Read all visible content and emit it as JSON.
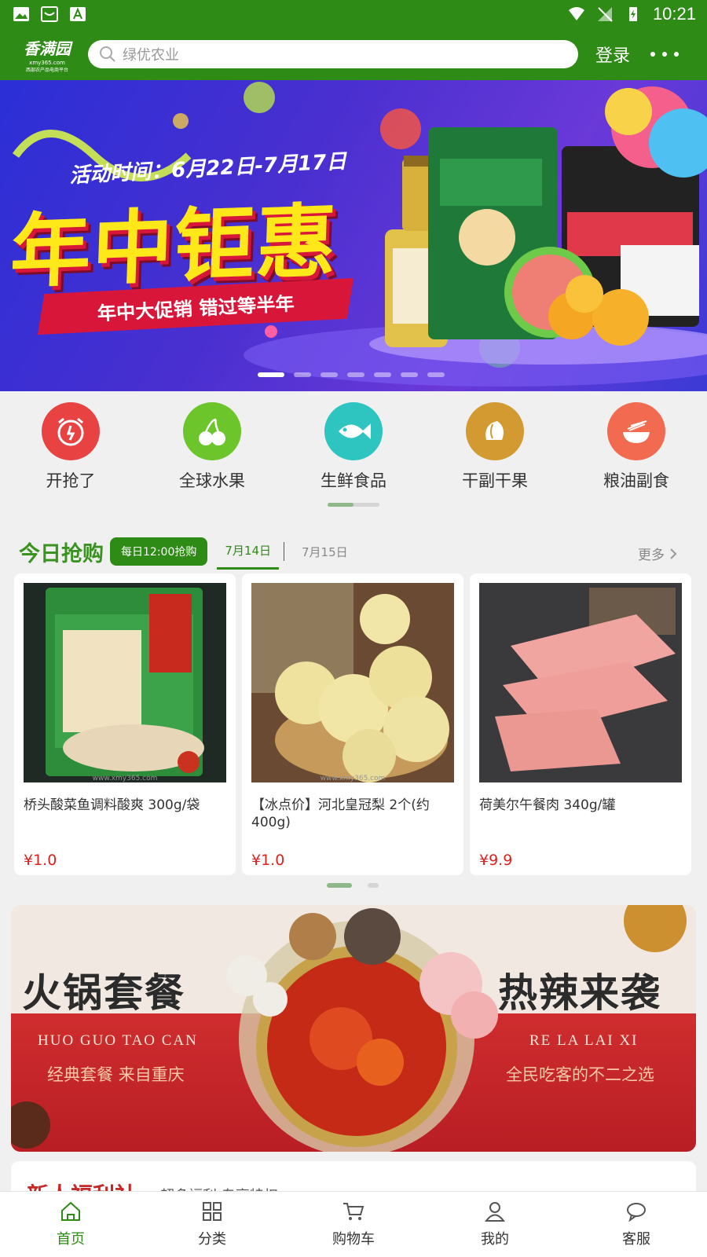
{
  "status_bar": {
    "time": "10:21"
  },
  "header": {
    "logo_text": "香满园",
    "logo_sub": "xmy365.com",
    "logo_tag": "西部农产品电商平台",
    "search_placeholder": "绿优农业",
    "login_label": "登录"
  },
  "banner": {
    "date_text": "活动时间：6月22日-7月17日",
    "title": "年中钜惠",
    "subtitle": "年中大促销 错过等半年",
    "slide_count": 7,
    "active_slide": 1
  },
  "categories": [
    {
      "label": "开抢了",
      "icon": "alarm-clock-icon",
      "color": "#e84242"
    },
    {
      "label": "全球水果",
      "icon": "cherry-icon",
      "color": "#6cc52a"
    },
    {
      "label": "生鲜食品",
      "icon": "fish-icon",
      "color": "#2ec4c0"
    },
    {
      "label": "干副干果",
      "icon": "nut-icon",
      "color": "#d29a30"
    },
    {
      "label": "粮油副食",
      "icon": "rice-bowl-icon",
      "color": "#f26a4f"
    }
  ],
  "flash_sale": {
    "title": "今日抢购",
    "badge": "每日12:00抢购",
    "tabs": [
      "7月14日",
      "7月15日"
    ],
    "more_label": "更多"
  },
  "products": [
    {
      "name": "桥头酸菜鱼调料酸爽 300g/袋",
      "price": "¥1.0",
      "watermark": "www.xmy365.com"
    },
    {
      "name": "【冰点价】河北皇冠梨 2个(约400g)",
      "price": "¥1.0",
      "watermark": "www.xmy365.com"
    },
    {
      "name": "荷美尔午餐肉 340g/罐",
      "price": "¥9.9",
      "watermark": ""
    }
  ],
  "promo": {
    "title_left": "火锅套餐",
    "pinyin_left": "HUO GUO TAO CAN",
    "sub_left": "经典套餐 来自重庆",
    "title_right": "热辣来袭",
    "pinyin_right": "RE LA LAI XI",
    "sub_right": "全民吃客的不二之选"
  },
  "welfare": {
    "title": "新人福利社",
    "subtitle": "超多福利 专享特权"
  },
  "bottom_nav": [
    {
      "label": "首页",
      "icon": "home-icon",
      "active": true
    },
    {
      "label": "分类",
      "icon": "grid-icon",
      "active": false
    },
    {
      "label": "购物车",
      "icon": "cart-icon",
      "active": false
    },
    {
      "label": "我的",
      "icon": "user-icon",
      "active": false
    },
    {
      "label": "客服",
      "icon": "chat-icon",
      "active": false
    }
  ],
  "colors": {
    "brand": "#2e8b16",
    "price": "#e02020",
    "accent_yellow": "#ffe81a"
  }
}
